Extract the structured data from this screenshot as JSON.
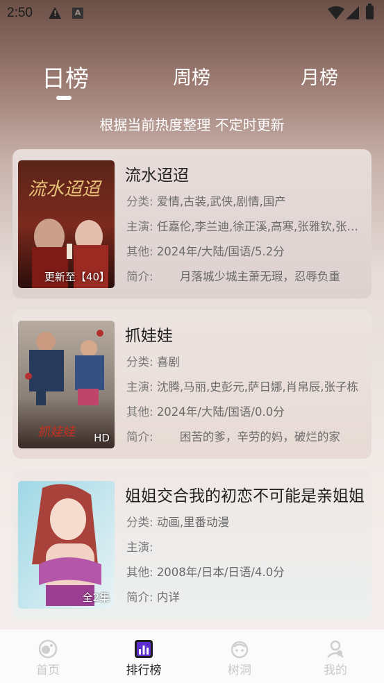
{
  "status_bar": {
    "time": "2:50"
  },
  "tabs": [
    {
      "label": "日榜",
      "active": true
    },
    {
      "label": "周榜",
      "active": false
    },
    {
      "label": "月榜",
      "active": false
    }
  ],
  "subtitle": "根据当前热度整理 不定时更新",
  "labels": {
    "category": "分类:",
    "cast": "主演:",
    "other": "其他:",
    "intro": "简介:"
  },
  "items": [
    {
      "title": "流水迢迢",
      "category": "爱情,古装,武侠,剧情,国产",
      "cast": "任嘉伦,李兰迪,徐正溪,高寒,张雅钦,张凌赫",
      "other": "2024年/大陆/国语/5.2分",
      "intro": "　　月落城少城主萧无瑕，忍辱负重",
      "badge": "更新至【40】",
      "poster_text": "流水迢迢"
    },
    {
      "title": "抓娃娃",
      "category": "喜剧",
      "cast": "沈腾,马丽,史彭元,萨日娜,肖帛辰,张子栋",
      "other": "2024年/大陆/国语/0.0分",
      "intro": "　　困苦的爹，辛劳的妈，破烂的家",
      "badge": "HD",
      "poster_text": "抓娃娃"
    },
    {
      "title": "姐姐交合我的初恋不可能是亲姐姐",
      "category": "动画,里番动漫",
      "cast": "",
      "other": "2008年/日本/日语/4.0分",
      "intro": "内详",
      "badge": "全2集",
      "poster_text": ""
    }
  ],
  "bottom_nav": [
    {
      "label": "首页",
      "icon": "home-planet-icon",
      "active": false
    },
    {
      "label": "排行榜",
      "icon": "ranking-bars-icon",
      "active": true
    },
    {
      "label": "树洞",
      "icon": "tree-hole-icon",
      "active": false
    },
    {
      "label": "我的",
      "icon": "profile-icon",
      "active": false
    }
  ],
  "colors": {
    "accent": "#5b2fd0",
    "inactive": "#c9c9c9"
  }
}
